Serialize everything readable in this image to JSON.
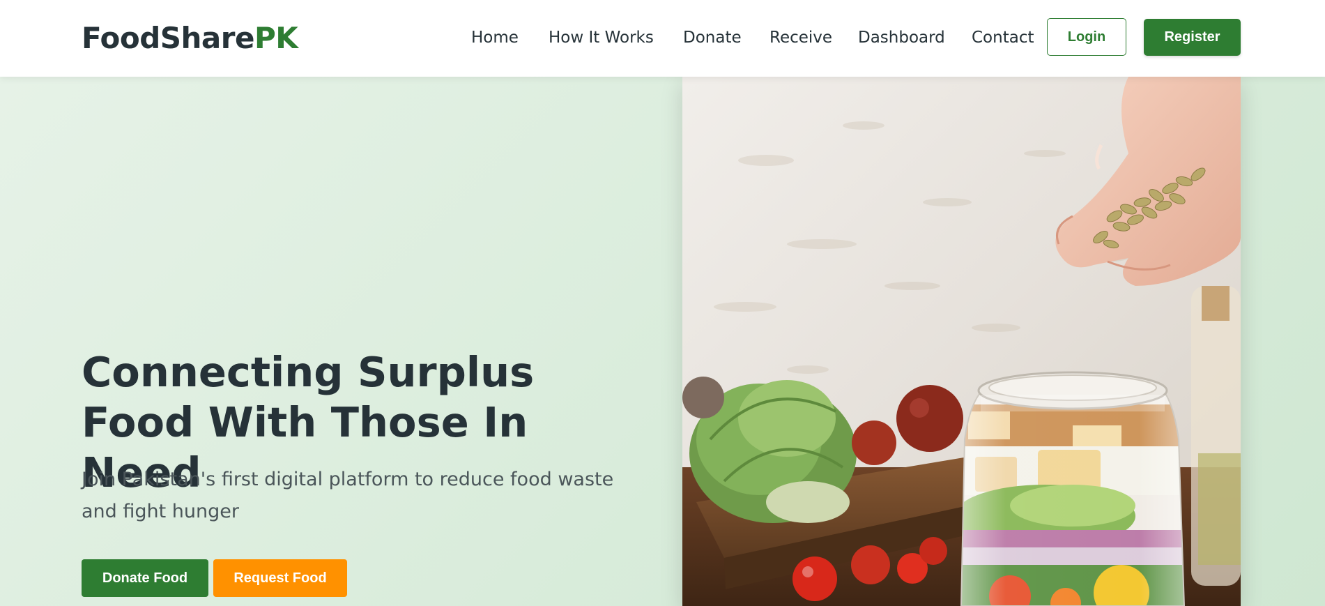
{
  "brand": {
    "name_part1": "FoodShare",
    "name_part2": "PK"
  },
  "nav": {
    "links": [
      "Home",
      "How It Works",
      "Donate",
      "Receive",
      "Dashboard",
      "Contact"
    ],
    "login_label": "Login",
    "register_label": "Register"
  },
  "hero": {
    "title": "Connecting Surplus Food With Those In Need",
    "subtitle": "Join Pakistan's first digital platform to reduce food waste and fight hunger",
    "donate_label": "Donate Food",
    "request_label": "Request Food"
  },
  "colors": {
    "primary": "#2e7d32",
    "accent": "#ff9100",
    "text": "#263238",
    "hero_background": "#e0efe1"
  }
}
